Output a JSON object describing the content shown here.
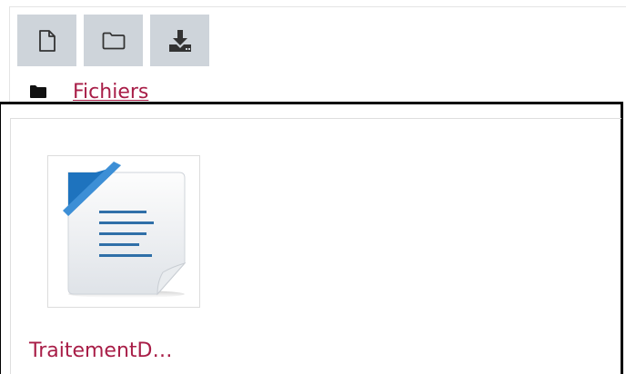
{
  "toolbar": {
    "buttons": [
      {
        "name": "new-file",
        "icon": "file-icon"
      },
      {
        "name": "new-folder",
        "icon": "folder-icon"
      },
      {
        "name": "download",
        "icon": "download-icon"
      }
    ]
  },
  "path": {
    "icon": "folder-icon",
    "label": "Fichiers"
  },
  "files": [
    {
      "name": "TraitementD…",
      "icon": "document-icon"
    }
  ],
  "colors": {
    "link": "#a81d47",
    "button_bg": "#ced4da",
    "frame": "#000000"
  }
}
